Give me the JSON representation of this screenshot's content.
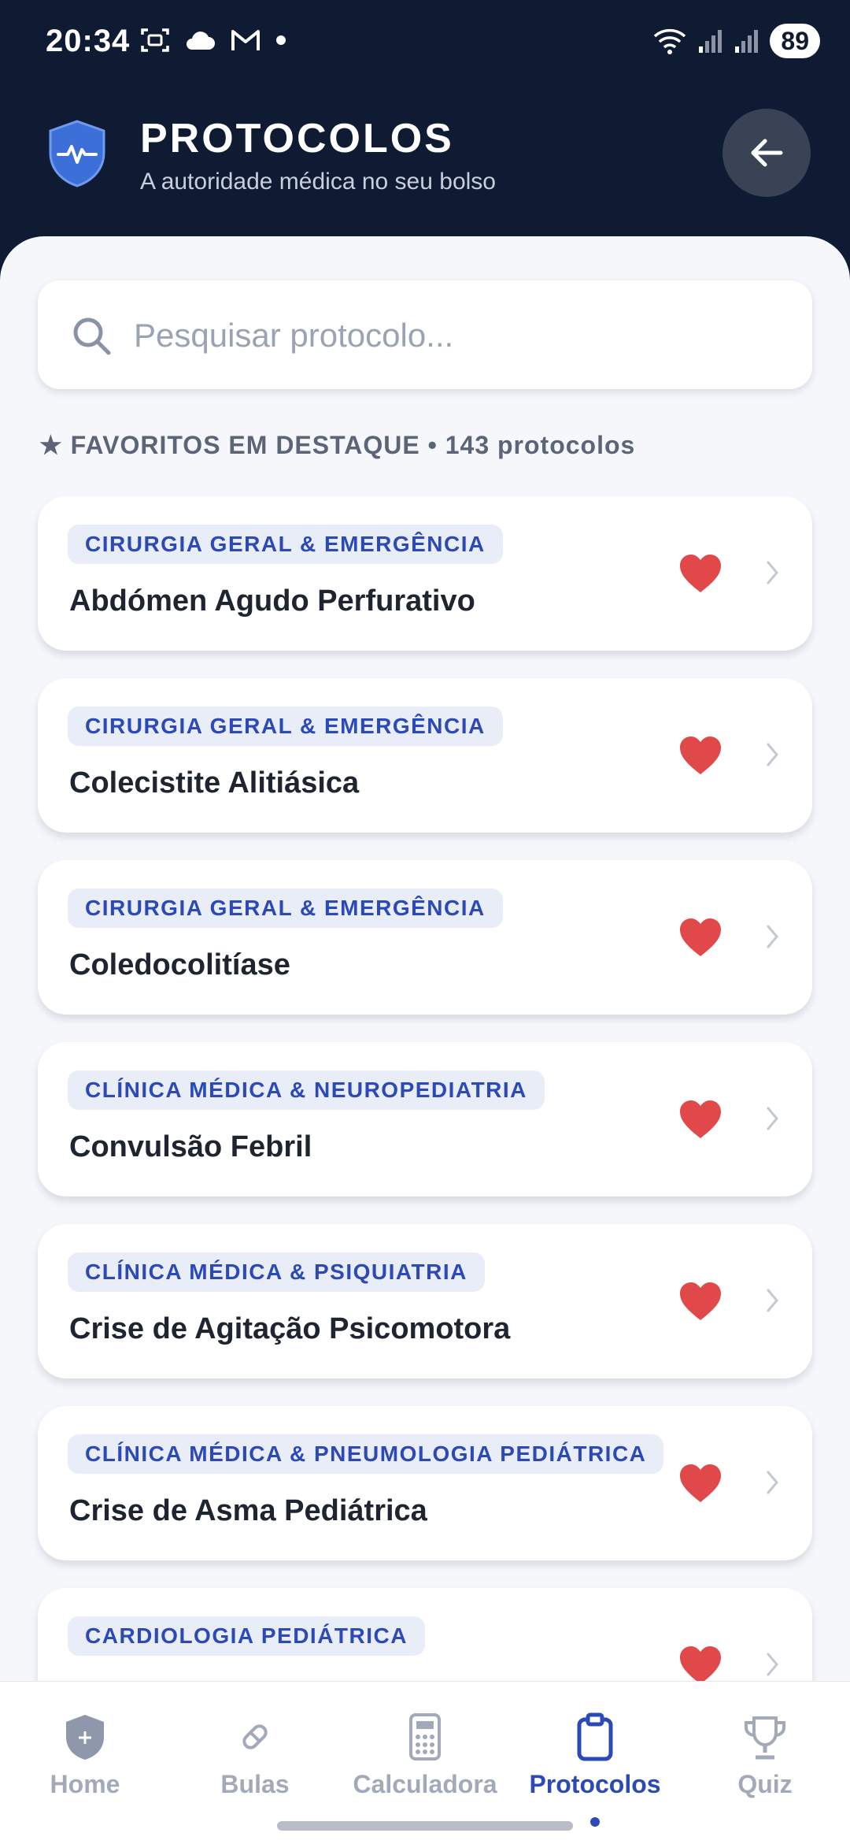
{
  "status_bar": {
    "time": "20:34",
    "battery": "89",
    "icons": [
      "screenshot-icon",
      "cloud-icon",
      "gmail-icon",
      "dot-icon",
      "wifi-icon",
      "signal-icon",
      "signal-icon"
    ]
  },
  "header": {
    "title": "PROTOCOLOS",
    "subtitle": "A autoridade médica no seu bolso",
    "logo_icon": "shield-heartbeat-icon",
    "back_icon": "arrow-left-icon"
  },
  "search": {
    "placeholder": "Pesquisar protocolo...",
    "value": ""
  },
  "section": {
    "label": "★ FAVORITOS EM DESTAQUE • 143 protocolos"
  },
  "protocols": [
    {
      "category": "CIRURGIA GERAL & EMERGÊNCIA",
      "title": "Abdómen Agudo Perfurativo",
      "favorite": true
    },
    {
      "category": "CIRURGIA GERAL & EMERGÊNCIA",
      "title": "Colecistite Alitiásica",
      "favorite": true
    },
    {
      "category": "CIRURGIA GERAL & EMERGÊNCIA",
      "title": "Coledocolitíase",
      "favorite": true
    },
    {
      "category": "CLÍNICA MÉDICA & NEUROPEDIATRIA",
      "title": "Convulsão Febril",
      "favorite": true
    },
    {
      "category": "CLÍNICA MÉDICA & PSIQUIATRIA",
      "title": "Crise de Agitação Psicomotora",
      "favorite": true
    },
    {
      "category": "CLÍNICA MÉDICA & PNEUMOLOGIA PEDIÁTRICA",
      "title": "Crise de Asma Pediátrica",
      "favorite": true
    },
    {
      "category": "CARDIOLOGIA PEDIÁTRICA",
      "title": "",
      "favorite": true
    }
  ],
  "nav": {
    "items": [
      {
        "label": "Home",
        "icon": "shield-icon"
      },
      {
        "label": "Bulas",
        "icon": "pill-icon"
      },
      {
        "label": "Calculadora",
        "icon": "calculator-icon"
      },
      {
        "label": "Protocolos",
        "icon": "clipboard-icon"
      },
      {
        "label": "Quiz",
        "icon": "trophy-icon"
      }
    ],
    "active": "Protocolos"
  },
  "colors": {
    "header_bg": "#0f1a33",
    "accent": "#2c49b8",
    "heart": "#e0484a",
    "panel_bg": "#f5f7fb"
  }
}
